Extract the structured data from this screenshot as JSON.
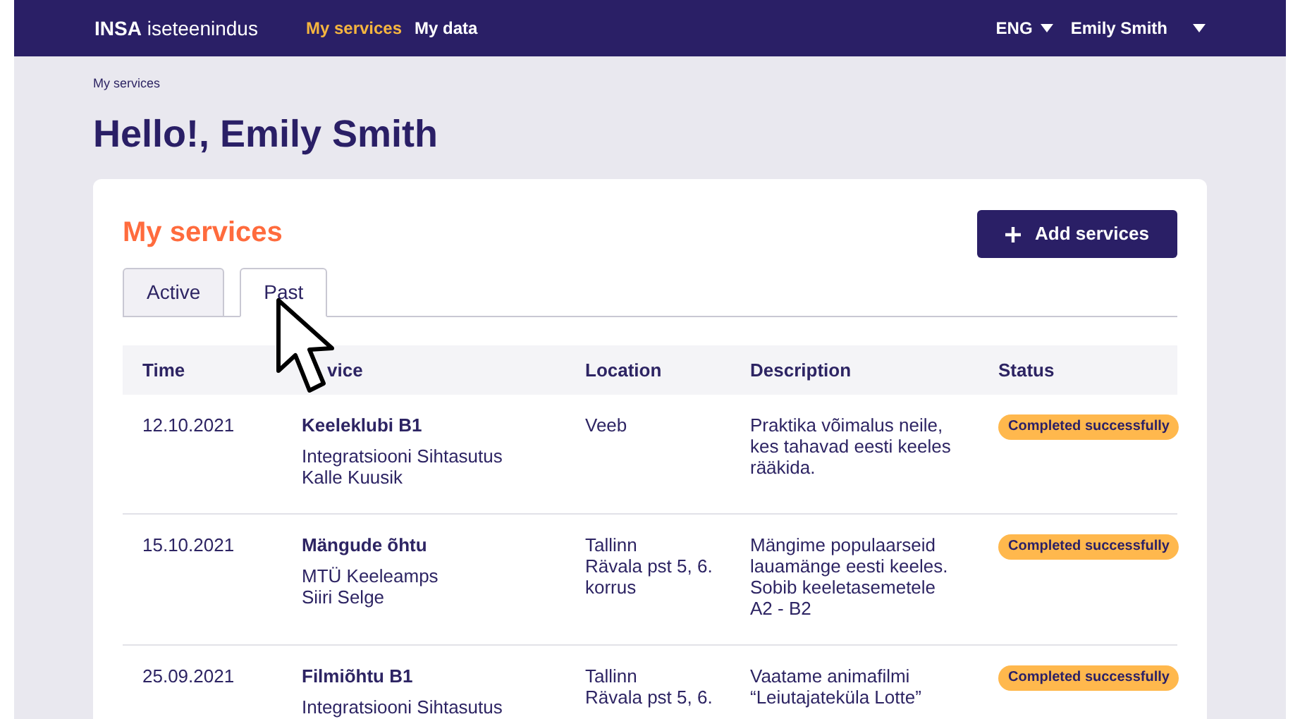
{
  "header": {
    "brand_bold": "INSA",
    "brand_light": "iseteenindus",
    "nav": [
      {
        "label": "My services",
        "selected": true
      },
      {
        "label": "My data",
        "selected": false
      }
    ],
    "language": "ENG",
    "user": "Emily Smith"
  },
  "breadcrumb": "My services",
  "greeting": "Hello!, Emily Smith",
  "card": {
    "title": "My services",
    "add_button": "Add services",
    "tabs": [
      {
        "label": "Active",
        "selected": false
      },
      {
        "label": "Past",
        "selected": true
      }
    ],
    "table": {
      "columns": [
        "Time",
        "vice",
        "Location",
        "Description",
        "Status"
      ],
      "rows": [
        {
          "time": "12.10.2021",
          "service": "Keeleklubi B1",
          "organization": "Integratsiooni Sihtasutus",
          "contact": "Kalle Kuusik",
          "location": [
            "Veeb"
          ],
          "description": [
            "Praktika võimalus neile,",
            "kes tahavad eesti keeles",
            "rääkida."
          ],
          "status": "Completed successfully"
        },
        {
          "time": "15.10.2021",
          "service": "Mängude õhtu",
          "organization": "MTÜ Keeleamps",
          "contact": "Siiri Selge",
          "location": [
            "Tallinn",
            "Rävala pst 5, 6.",
            "korrus"
          ],
          "description": [
            "Mängime populaarseid",
            "lauamänge eesti keeles.",
            "Sobib keeletasemetele",
            "A2 - B2"
          ],
          "status": "Completed successfully"
        },
        {
          "time": "25.09.2021",
          "service": "Filmiõhtu B1",
          "organization": "Integratsiooni Sihtasutus",
          "location": [
            "Tallinn",
            "Rävala pst 5, 6."
          ],
          "description": [
            "Vaatame animafilmi",
            "“Leiutajateküla Lotte”"
          ],
          "status": "Completed successfully"
        }
      ]
    }
  }
}
